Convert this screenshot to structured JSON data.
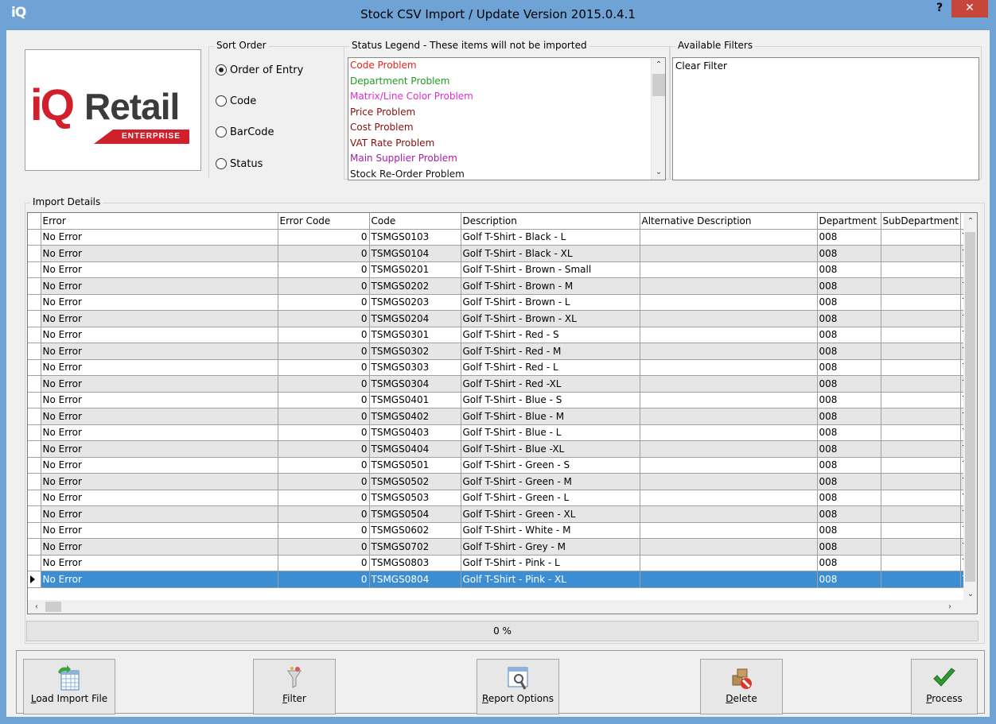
{
  "window": {
    "app_icon": "iQ",
    "title": "Stock CSV Import / Update Version 2015.0.4.1",
    "help": "?",
    "close": "✕"
  },
  "logo": {
    "iq": "iQ",
    "retail": "Retail",
    "edition": "ENTERPRISE"
  },
  "sort_order": {
    "label": "Sort Order",
    "options": [
      "Order of Entry",
      "Code",
      "BarCode",
      "Status"
    ],
    "selected": "Order of Entry"
  },
  "status_legend": {
    "label": "Status Legend - These items will not be imported",
    "items": [
      {
        "text": "Code Problem",
        "color": "#e8211c"
      },
      {
        "text": "Department Problem",
        "color": "#1f9c1f"
      },
      {
        "text": "Matrix/Line Color Problem",
        "color": "#e02ad6"
      },
      {
        "text": "Price Problem",
        "color": "#8b0d0d"
      },
      {
        "text": "Cost Problem",
        "color": "#8b0d0d"
      },
      {
        "text": "VAT Rate Problem",
        "color": "#8b0d0d"
      },
      {
        "text": "Main Supplier Problem",
        "color": "#a420a4"
      },
      {
        "text": "Stock Re-Order Problem",
        "color": "#111111"
      }
    ]
  },
  "available_filters": {
    "label": "Available Filters",
    "items": [
      "Clear Filter"
    ]
  },
  "import_details": {
    "label": "Import Details",
    "columns": [
      "Error",
      "Error Code",
      "Code",
      "Description",
      "Alternative Description",
      "Department",
      "SubDepartment",
      "B"
    ],
    "rows": [
      [
        "No Error",
        "0",
        "TSMGS0103",
        "Golf T-Shirt - Black - L",
        "",
        "008",
        "",
        "T"
      ],
      [
        "No Error",
        "0",
        "TSMGS0104",
        "Golf T-Shirt - Black - XL",
        "",
        "008",
        "",
        "T"
      ],
      [
        "No Error",
        "0",
        "TSMGS0201",
        "Golf T-Shirt - Brown - Small",
        "",
        "008",
        "",
        "T"
      ],
      [
        "No Error",
        "0",
        "TSMGS0202",
        "Golf T-Shirt - Brown - M",
        "",
        "008",
        "",
        "T"
      ],
      [
        "No Error",
        "0",
        "TSMGS0203",
        "Golf T-Shirt - Brown - L",
        "",
        "008",
        "",
        "T"
      ],
      [
        "No Error",
        "0",
        "TSMGS0204",
        "Golf T-Shirt - Brown - XL",
        "",
        "008",
        "",
        "T"
      ],
      [
        "No Error",
        "0",
        "TSMGS0301",
        "Golf T-Shirt - Red - S",
        "",
        "008",
        "",
        "T"
      ],
      [
        "No Error",
        "0",
        "TSMGS0302",
        "Golf T-Shirt - Red - M",
        "",
        "008",
        "",
        "T"
      ],
      [
        "No Error",
        "0",
        "TSMGS0303",
        "Golf T-Shirt - Red - L",
        "",
        "008",
        "",
        "T"
      ],
      [
        "No Error",
        "0",
        "TSMGS0304",
        "Golf T-Shirt - Red -XL",
        "",
        "008",
        "",
        "T"
      ],
      [
        "No Error",
        "0",
        "TSMGS0401",
        "Golf T-Shirt - Blue - S",
        "",
        "008",
        "",
        "T"
      ],
      [
        "No Error",
        "0",
        "TSMGS0402",
        "Golf T-Shirt - Blue - M",
        "",
        "008",
        "",
        "T"
      ],
      [
        "No Error",
        "0",
        "TSMGS0403",
        "Golf T-Shirt - Blue - L",
        "",
        "008",
        "",
        "T"
      ],
      [
        "No Error",
        "0",
        "TSMGS0404",
        "Golf T-Shirt - Blue -XL",
        "",
        "008",
        "",
        "T"
      ],
      [
        "No Error",
        "0",
        "TSMGS0501",
        "Golf T-Shirt - Green - S",
        "",
        "008",
        "",
        "T"
      ],
      [
        "No Error",
        "0",
        "TSMGS0502",
        "Golf T-Shirt - Green - M",
        "",
        "008",
        "",
        "T"
      ],
      [
        "No Error",
        "0",
        "TSMGS0503",
        "Golf T-Shirt - Green - L",
        "",
        "008",
        "",
        "T"
      ],
      [
        "No Error",
        "0",
        "TSMGS0504",
        "Golf T-Shirt - Green - XL",
        "",
        "008",
        "",
        "T"
      ],
      [
        "No Error",
        "0",
        "TSMGS0602",
        "Golf T-Shirt - White - M",
        "",
        "008",
        "",
        "T"
      ],
      [
        "No Error",
        "0",
        "TSMGS0702",
        "Golf T-Shirt - Grey - M",
        "",
        "008",
        "",
        "T"
      ],
      [
        "No Error",
        "0",
        "TSMGS0803",
        "Golf T-Shirt - Pink - L",
        "",
        "008",
        "",
        "T"
      ],
      [
        "No Error",
        "0",
        "TSMGS0804",
        "Golf T-Shirt - Pink - XL",
        "",
        "008",
        "",
        "T"
      ]
    ],
    "selected_row": 21
  },
  "progress": {
    "text": "0 %",
    "percent": 0
  },
  "buttons": {
    "load": "Load Import File",
    "filter": "Filter",
    "report": "Report Options",
    "delete": "Delete",
    "process": "Process"
  },
  "icons": {
    "load": "spreadsheet-import-icon",
    "filter": "funnel-icon",
    "report": "report-magnifier-icon",
    "delete": "delete-boxes-icon",
    "process": "checkmark-icon"
  },
  "colors": {
    "selection": "#3b8ed3",
    "close": "#c7463b",
    "title_bar": "#6fa3d6",
    "logo_red": "#d11f2b"
  }
}
